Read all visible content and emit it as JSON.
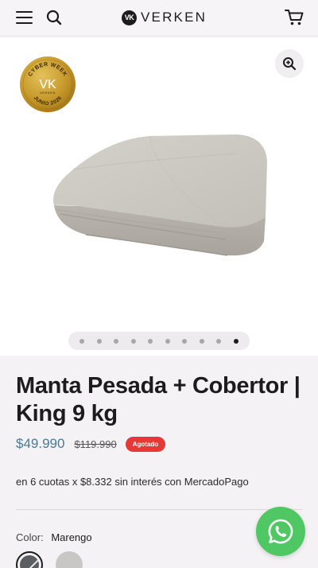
{
  "header": {
    "brand_name": "VERKEN",
    "brand_mark": "VK",
    "menu_icon": "hamburger-icon",
    "search_icon": "search-icon",
    "cart_icon": "cart-icon"
  },
  "gallery": {
    "badge": {
      "top_text": "CYBER WEEK",
      "mark": "VK",
      "brand": "VERKEN",
      "bottom_text": "JUNIO 2026"
    },
    "zoom_icon": "zoom-in-icon",
    "slide_count": 10,
    "active_slide": 10,
    "image_color": "#c9c6c0"
  },
  "product": {
    "title": "Manta Pesada + Cobertor | King 9 kg",
    "price": "$49.990",
    "old_price": "$119.990",
    "status": "Agotado",
    "installments": "en 6 cuotas x $8.332 sin interés con MercadoPago",
    "color_label": "Color:",
    "color_value": "Marengo",
    "swatches": [
      {
        "name": "Marengo",
        "color": "#5c5d61",
        "selected": true,
        "sold_out": true
      },
      {
        "name": "Gris claro",
        "color": "#c9c7c6",
        "selected": false,
        "sold_out": false
      }
    ]
  },
  "colors": {
    "accent_price": "#4b7a90",
    "badge_red": "#e53935",
    "whatsapp_green": "#4fc863"
  },
  "whatsapp": {
    "icon": "whatsapp-icon"
  }
}
